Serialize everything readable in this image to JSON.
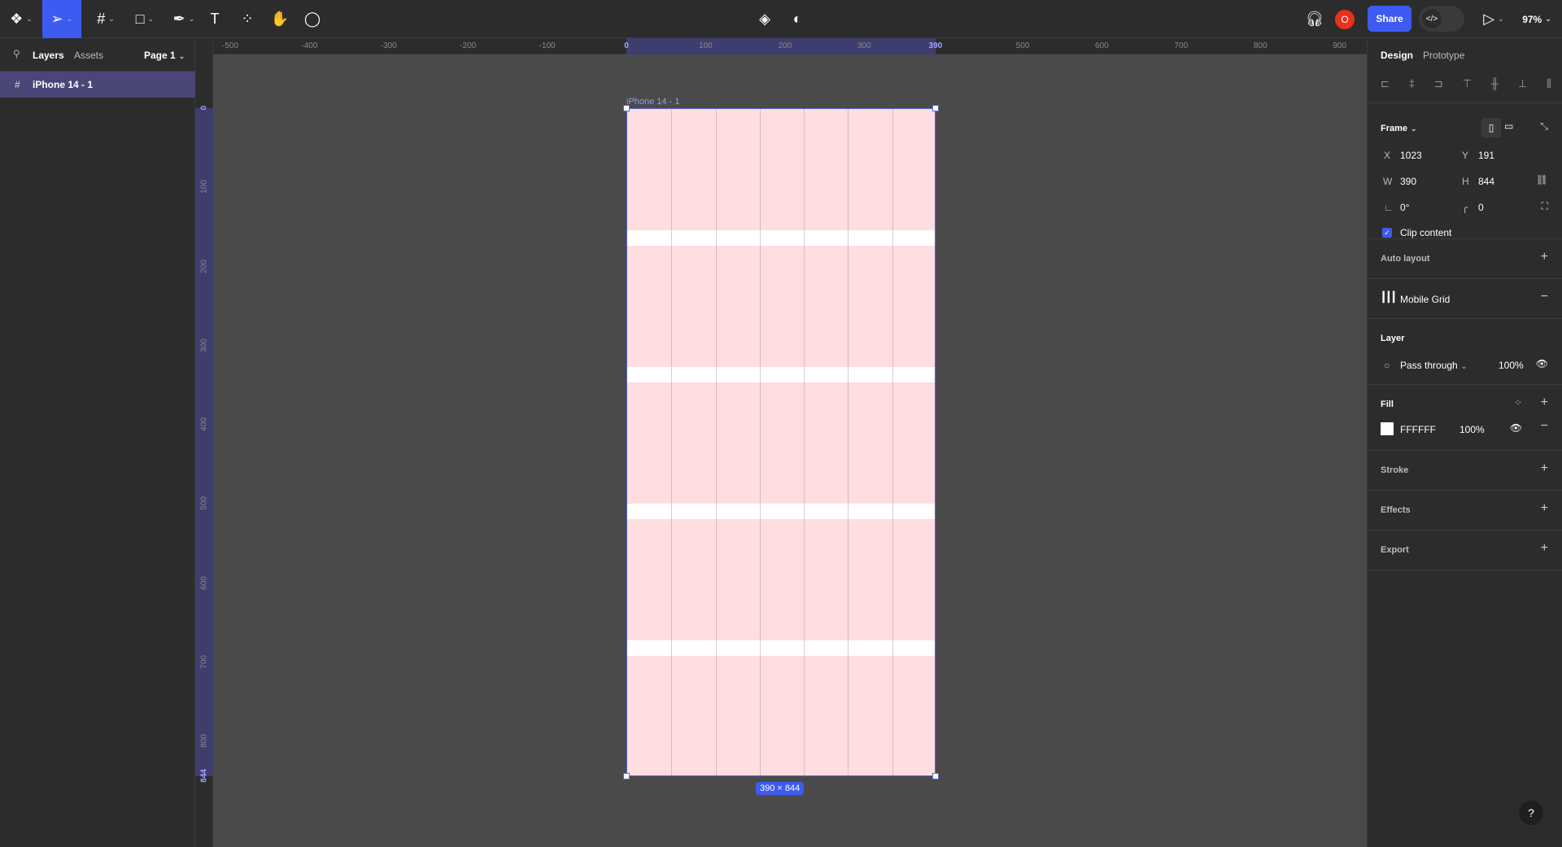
{
  "toolbar": {
    "tools": [
      {
        "icon": "figma-menu-icon"
      },
      {
        "icon": "move-tool-icon",
        "active": true
      },
      {
        "icon": "frame-tool-icon"
      },
      {
        "icon": "rectangle-tool-icon"
      },
      {
        "icon": "pen-tool-icon"
      },
      {
        "icon": "text-tool-icon"
      },
      {
        "icon": "resources-icon"
      },
      {
        "icon": "hand-tool-icon"
      },
      {
        "icon": "comment-icon"
      }
    ],
    "center": [
      {
        "icon": "component-icon"
      },
      {
        "icon": "contrast-icon"
      }
    ],
    "avatar": "O",
    "share": "Share",
    "zoom": "97%",
    "accent": "#3d5af1",
    "avatar_color": "#e8301d"
  },
  "left_panel": {
    "tabs": [
      "Layers",
      "Assets"
    ],
    "page": "Page 1",
    "layers": [
      {
        "name": "iPhone 14 - 1",
        "selected": true
      }
    ]
  },
  "rulers": {
    "top": [
      "-500",
      "-400",
      "-300",
      "-200",
      "-100",
      "0",
      "100",
      "200",
      "300",
      "390",
      "500",
      "600",
      "700",
      "800",
      "900"
    ],
    "left": [
      "0",
      "100",
      "200",
      "300",
      "400",
      "500",
      "600",
      "700",
      "800",
      "844"
    ]
  },
  "canvas": {
    "frame_name": "iPhone 14 - 1",
    "size_label": "390 × 844",
    "grid_color": "#ffdde0"
  },
  "right_panel": {
    "tabs": [
      "Design",
      "Prototype"
    ],
    "frame": {
      "title": "Frame",
      "x_label": "X",
      "x": "1023",
      "y_label": "Y",
      "y": "191",
      "w_label": "W",
      "w": "390",
      "h_label": "H",
      "h": "844",
      "rotation": "0°",
      "radius": "0",
      "clip": "Clip content"
    },
    "auto_layout": "Auto layout",
    "grid": "Mobile Grid",
    "layer": {
      "title": "Layer",
      "blend": "Pass through",
      "opacity": "100%"
    },
    "fill": {
      "title": "Fill",
      "hex": "FFFFFF",
      "opacity": "100%"
    },
    "stroke": "Stroke",
    "effects": "Effects",
    "export": "Export",
    "help": "?"
  }
}
